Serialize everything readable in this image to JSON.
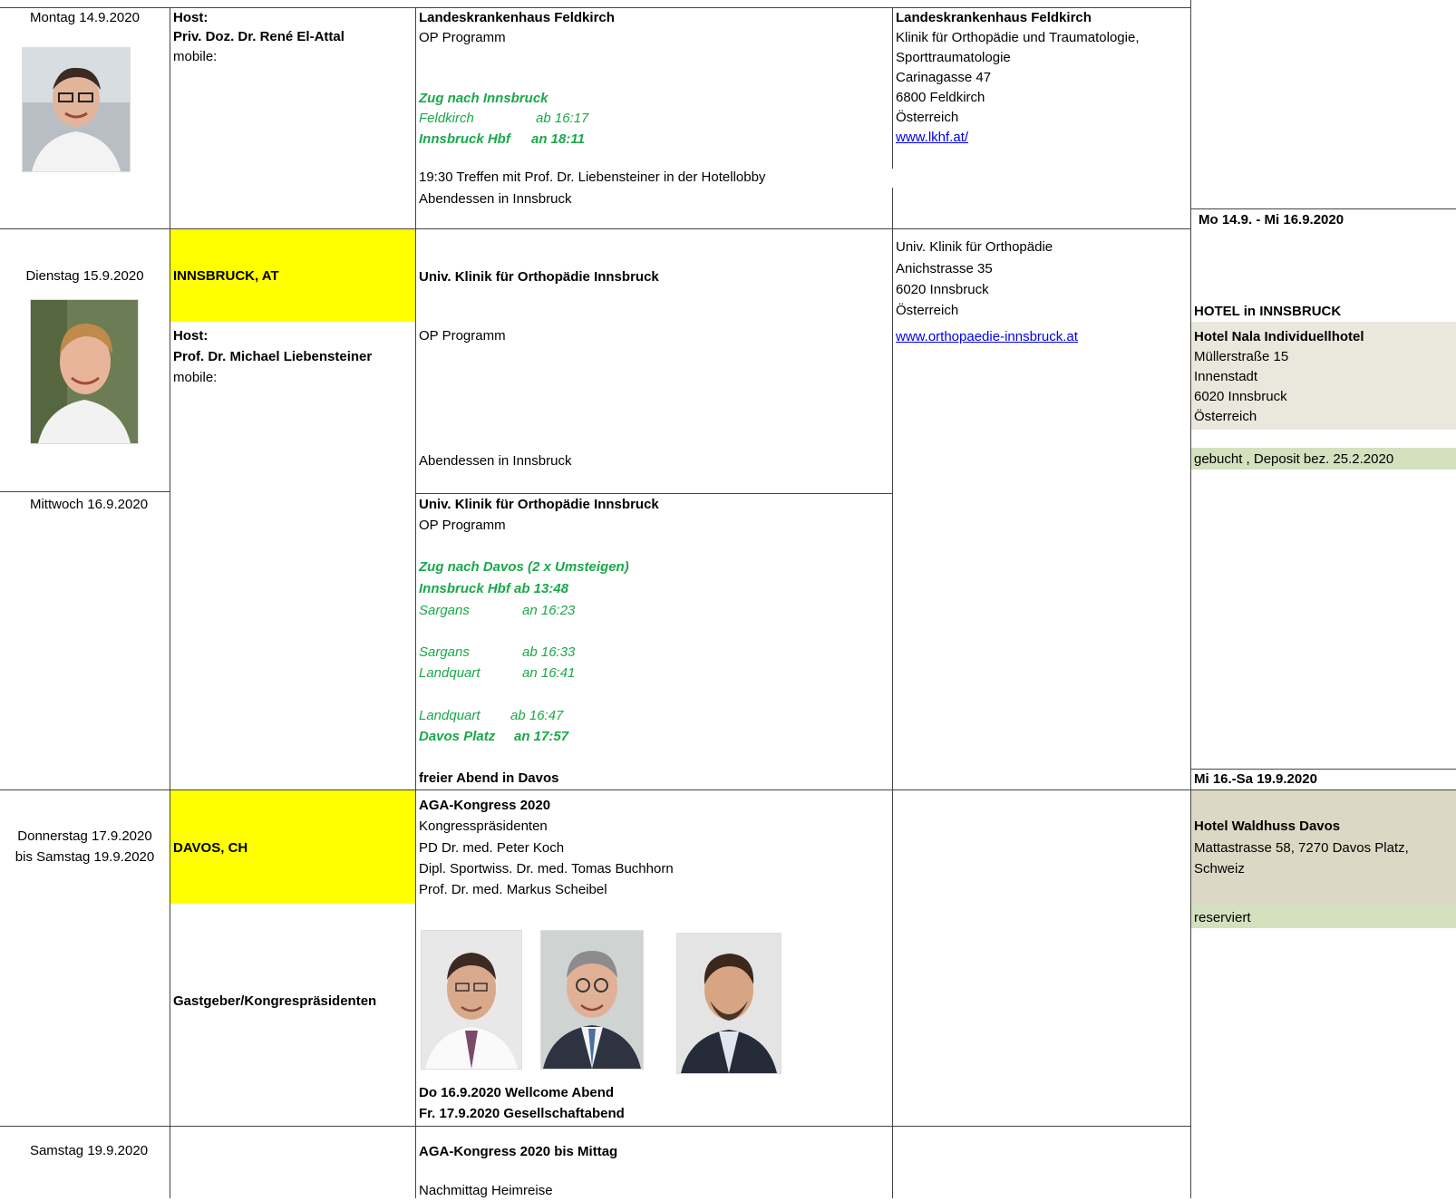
{
  "days": {
    "mon": {
      "date": "Montag 14.9.2020",
      "host_label": "Host:",
      "host_name": "Priv. Doz. Dr. René El-Attal",
      "mobile": "mobile:",
      "program": [
        "Landeskrankenhaus Feldkirch",
        "OP Programm"
      ],
      "train": {
        "title": "Zug nach Innsbruck",
        "l1": "Feldkirch",
        "t1": "ab 16:17",
        "l2": "Innsbruck Hbf",
        "t2": "an 18:11"
      },
      "evening": [
        "19:30 Treffen mit Prof. Dr. Liebensteiner in der Hotellobby",
        "Abendessen in Innsbruck"
      ],
      "address": [
        "Landeskrankenhaus Feldkirch",
        "Klinik für Orthopädie und Traumatologie,",
        "Sporttraumatologie",
        "Carinagasse 47",
        "6800 Feldkirch",
        "Österreich"
      ],
      "link": "www.lkhf.at/ "
    },
    "tue": {
      "date": "Dienstag 15.9.2020",
      "city": "INNSBRUCK, AT",
      "host_label": "Host:",
      "host_name": "Prof. Dr. Michael Liebensteiner",
      "mobile": "mobile:",
      "program_title": "Univ. Klinik für Orthopädie Innsbruck",
      "program": "OP Programm",
      "evening": "Abendessen in Innsbruck",
      "address": [
        "Univ. Klinik für Orthopädie",
        "Anichstrasse 35",
        "6020 Innsbruck",
        "Österreich"
      ],
      "link": "www.orthopaedie-innsbruck.at "
    },
    "wed": {
      "date": "Mittwoch 16.9.2020",
      "program_title": "Univ. Klinik für Orthopädie Innsbruck",
      "program": "OP Programm",
      "train_title": "Zug nach Davos (2 x Umsteigen)",
      "train": [
        "Innsbruck Hbf ab 13:48"
      ],
      "legs": [
        {
          "place": "Sargans",
          "time": "an 16:23"
        },
        {
          "place": "Sargans",
          "time": "ab 16:33"
        },
        {
          "place": "Landquart",
          "time": "an 16:41"
        },
        {
          "place": "Landquart",
          "time": "ab 16:47"
        },
        {
          "place": "Davos Platz",
          "time": "an 17:57"
        }
      ],
      "evening": "freier Abend in Davos"
    },
    "thu": {
      "date1": "Donnerstag 17.9.2020",
      "date2": "bis Samstag 19.9.2020",
      "city": "DAVOS, CH",
      "hosts_label": "Gastgeber/Kongrespräsidenten",
      "program_title": "AGA-Kongress 2020",
      "lines": [
        "Kongresspräsidenten",
        "PD Dr. med. Peter Koch",
        "Dipl. Sportwiss. Dr. med. Tomas Buchhorn",
        "Prof. Dr. med. Markus Scheibel"
      ],
      "events": [
        "Do 16.9.2020 Wellcome Abend",
        "Fr. 17.9.2020 Gesellschaftabend"
      ]
    },
    "sat": {
      "date": "Samstag 19.9.2020",
      "program_title": "AGA-Kongress 2020 bis Mittag",
      "program": "Nachmittag Heimreise"
    }
  },
  "hotels": {
    "innsbruck": {
      "period": "Mo 14.9. - Mi 16.9.2020",
      "heading": "HOTEL in INNSBRUCK",
      "name": "Hotel Nala Individuellhotel",
      "address": [
        "Müllerstraße 15",
        "Innenstadt",
        "6020 Innsbruck",
        "Österreich"
      ],
      "status": "gebucht , Deposit bez. 25.2.2020"
    },
    "davos": {
      "period": "Mi 16.-Sa 19.9.2020",
      "name": "Hotel Waldhuss Davos",
      "address": [
        "Mattastrasse 58, 7270 Davos Platz,",
        "Schweiz"
      ],
      "status": "reserviert"
    }
  }
}
